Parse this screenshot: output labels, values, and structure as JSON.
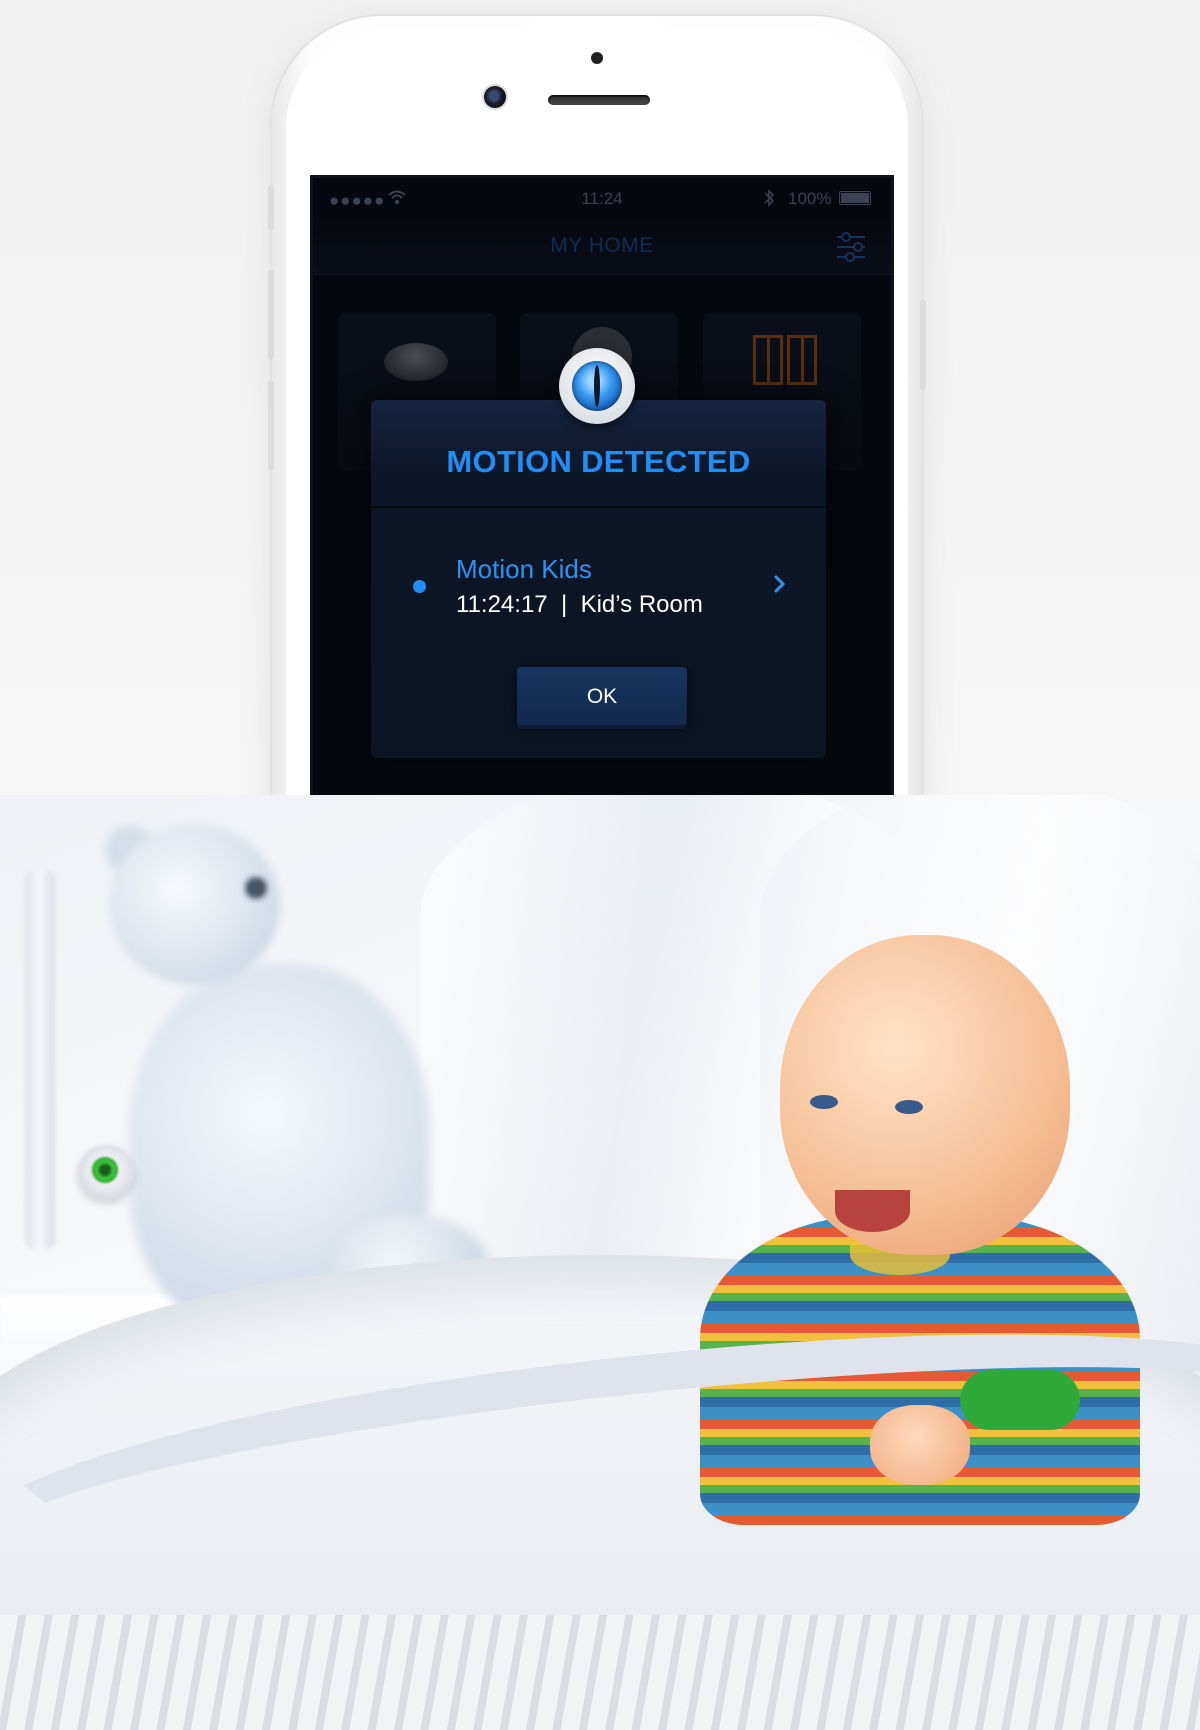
{
  "status_bar": {
    "signal": "●●●●●",
    "time": "11:24",
    "battery": "100%"
  },
  "app": {
    "title": "MY HOME"
  },
  "dialog": {
    "title": "MOTION DETECTED",
    "event": {
      "name": "Motion Kids",
      "time": "11:24:17",
      "separator": "|",
      "room": "Kid’s Room"
    },
    "ok_label": "OK"
  },
  "colors": {
    "accent": "#1f8ef6",
    "dialog_bg": "#0c1628",
    "screen_bg": "#060810",
    "ok_button": "#17355f"
  },
  "icons": {
    "filter": "sliders-icon",
    "wifi": "wifi-icon",
    "bluetooth": "bluetooth-icon",
    "event_chevron": "chevron-right-icon",
    "detector": "eye-sensor-icon"
  }
}
